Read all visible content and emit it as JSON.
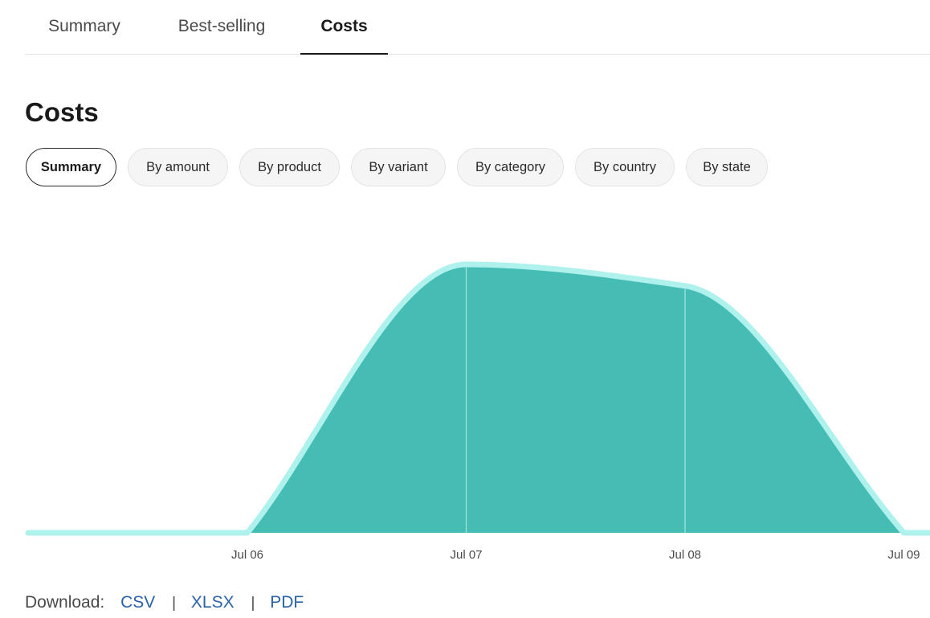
{
  "tabs": [
    {
      "label": "Summary",
      "active": false
    },
    {
      "label": "Best-selling",
      "active": false
    },
    {
      "label": "Costs",
      "active": true
    }
  ],
  "page_title": "Costs",
  "filters": [
    {
      "label": "Summary",
      "active": true
    },
    {
      "label": "By amount",
      "active": false
    },
    {
      "label": "By product",
      "active": false
    },
    {
      "label": "By variant",
      "active": false
    },
    {
      "label": "By category",
      "active": false
    },
    {
      "label": "By country",
      "active": false
    },
    {
      "label": "By state",
      "active": false
    }
  ],
  "chart_data": {
    "type": "area",
    "x": [
      "Jul 06",
      "Jul 07",
      "Jul 08",
      "Jul 09"
    ],
    "series": [
      {
        "values": [
          0,
          1.0,
          0.92,
          0
        ]
      }
    ],
    "colors": {
      "fill": "#45bcb4",
      "line": "#aef1ed",
      "gridline": "#a9e6e2"
    },
    "grid": "vertical lines at data points",
    "legend": "none",
    "ylim": [
      0,
      1.0
    ]
  },
  "download": {
    "label": "Download:",
    "links": [
      "CSV",
      "XLSX",
      "PDF"
    ],
    "separator": "|"
  }
}
